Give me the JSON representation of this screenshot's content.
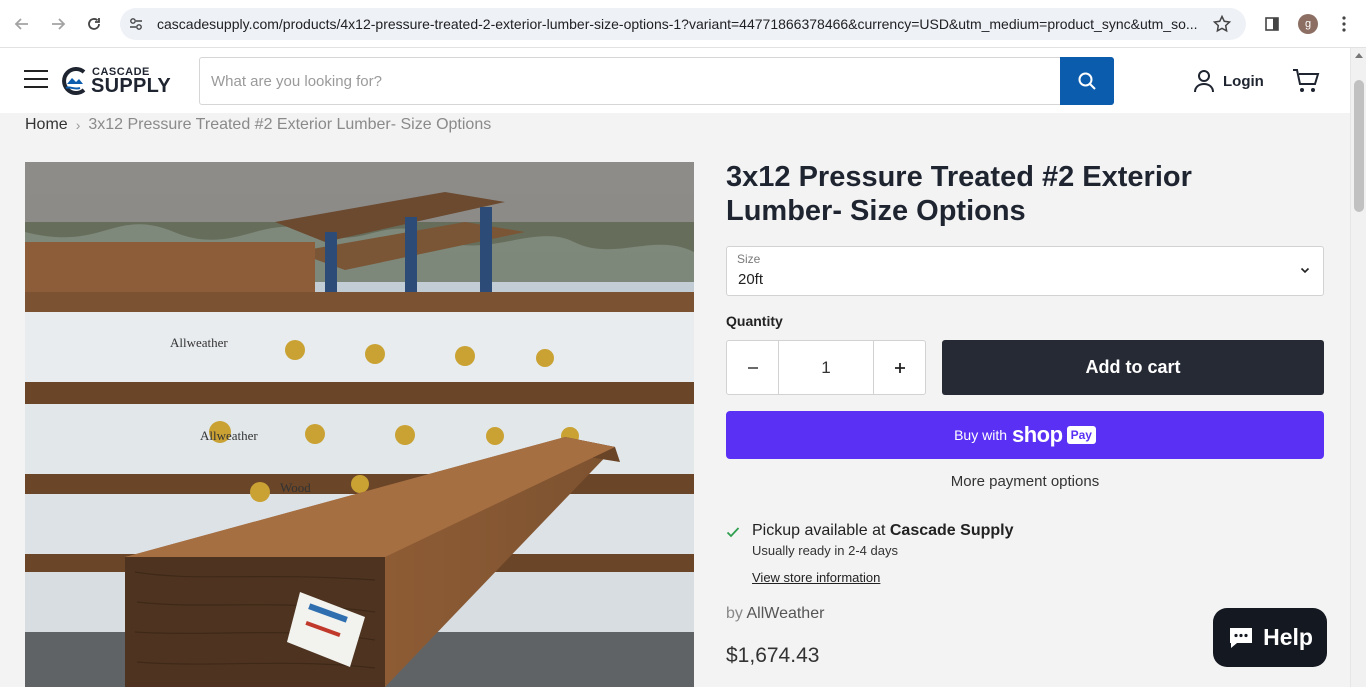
{
  "browser": {
    "url": "cascadesupply.com/products/4x12-pressure-treated-2-exterior-lumber-size-options-1?variant=44771866378466&currency=USD&utm_medium=product_sync&utm_so...",
    "profile_initial": "g"
  },
  "header": {
    "logo_top": "CASCADE",
    "logo_bottom": "SUPPLY",
    "search_placeholder": "What are you looking for?",
    "login_label": "Login"
  },
  "breadcrumb": {
    "home": "Home",
    "separator": "›",
    "current": "3x12 Pressure Treated #2 Exterior Lumber- Size Options"
  },
  "product": {
    "title": "3x12 Pressure Treated #2 Exterior Lumber- Size Options",
    "size_label": "Size",
    "size_value": "20ft",
    "quantity_label": "Quantity",
    "quantity_value": "1",
    "add_to_cart": "Add to cart",
    "buy_with": "Buy with",
    "shop_word": "shop",
    "pay_word": "Pay",
    "more_payment": "More payment options",
    "pickup_prefix": "Pickup available at",
    "pickup_store": "Cascade Supply",
    "pickup_ready": "Usually ready in 2-4 days",
    "store_info_link": "View store information",
    "vendor_prefix": "by",
    "vendor": "AllWeather",
    "price": "$1,674.43"
  },
  "image_labels": {
    "wrap_brand": "Allweather",
    "wrap_brand_2": "Wood"
  },
  "help": {
    "label": "Help"
  },
  "colors": {
    "accent_blue": "#0b5cad",
    "shop_pay": "#5a31f4",
    "dark_button": "#262a35",
    "check_green": "#2e9e4f"
  }
}
